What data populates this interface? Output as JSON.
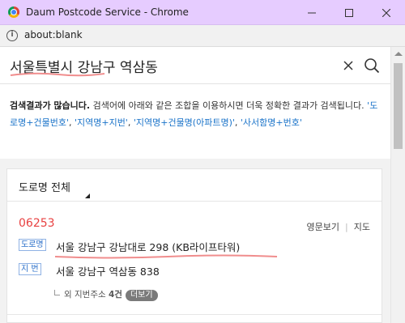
{
  "window": {
    "title": "Daum Postcode Service - Chrome",
    "url": "about:blank",
    "accent": "#e6ccff"
  },
  "search": {
    "query": "서울특별시 강남구 역삼동",
    "clear_icon": "close-icon",
    "search_icon": "search-icon"
  },
  "info": {
    "strong": "검색결과가 많습니다.",
    "text": " 검색어에 아래와 같은 조합을 이용하시면 더욱 정확한 결과가 검색됩니다.",
    "examples": [
      "'도로명+건물번호'",
      "'지역명+지번'",
      "'지역명+건물명(아파트명)'",
      "'사서함명+번호'"
    ],
    "sep": ","
  },
  "filter": {
    "label": "도로명 전체"
  },
  "results": [
    {
      "postcode": "06253",
      "english_link": "영문보기",
      "map_link": "지도",
      "road_badge": "도로명",
      "road_address": "서울 강남구 강남대로 298 (KB라이프타워)",
      "jibun_badge": "지 번",
      "jibun_address": "서울 강남구 역삼동 838",
      "more_prefix": "외 지번주소",
      "more_count": "4건",
      "more_button": "더보기"
    }
  ],
  "colors": {
    "postcode": "#e84141",
    "link": "#1a73c9",
    "badge": "#2a6fc9"
  }
}
